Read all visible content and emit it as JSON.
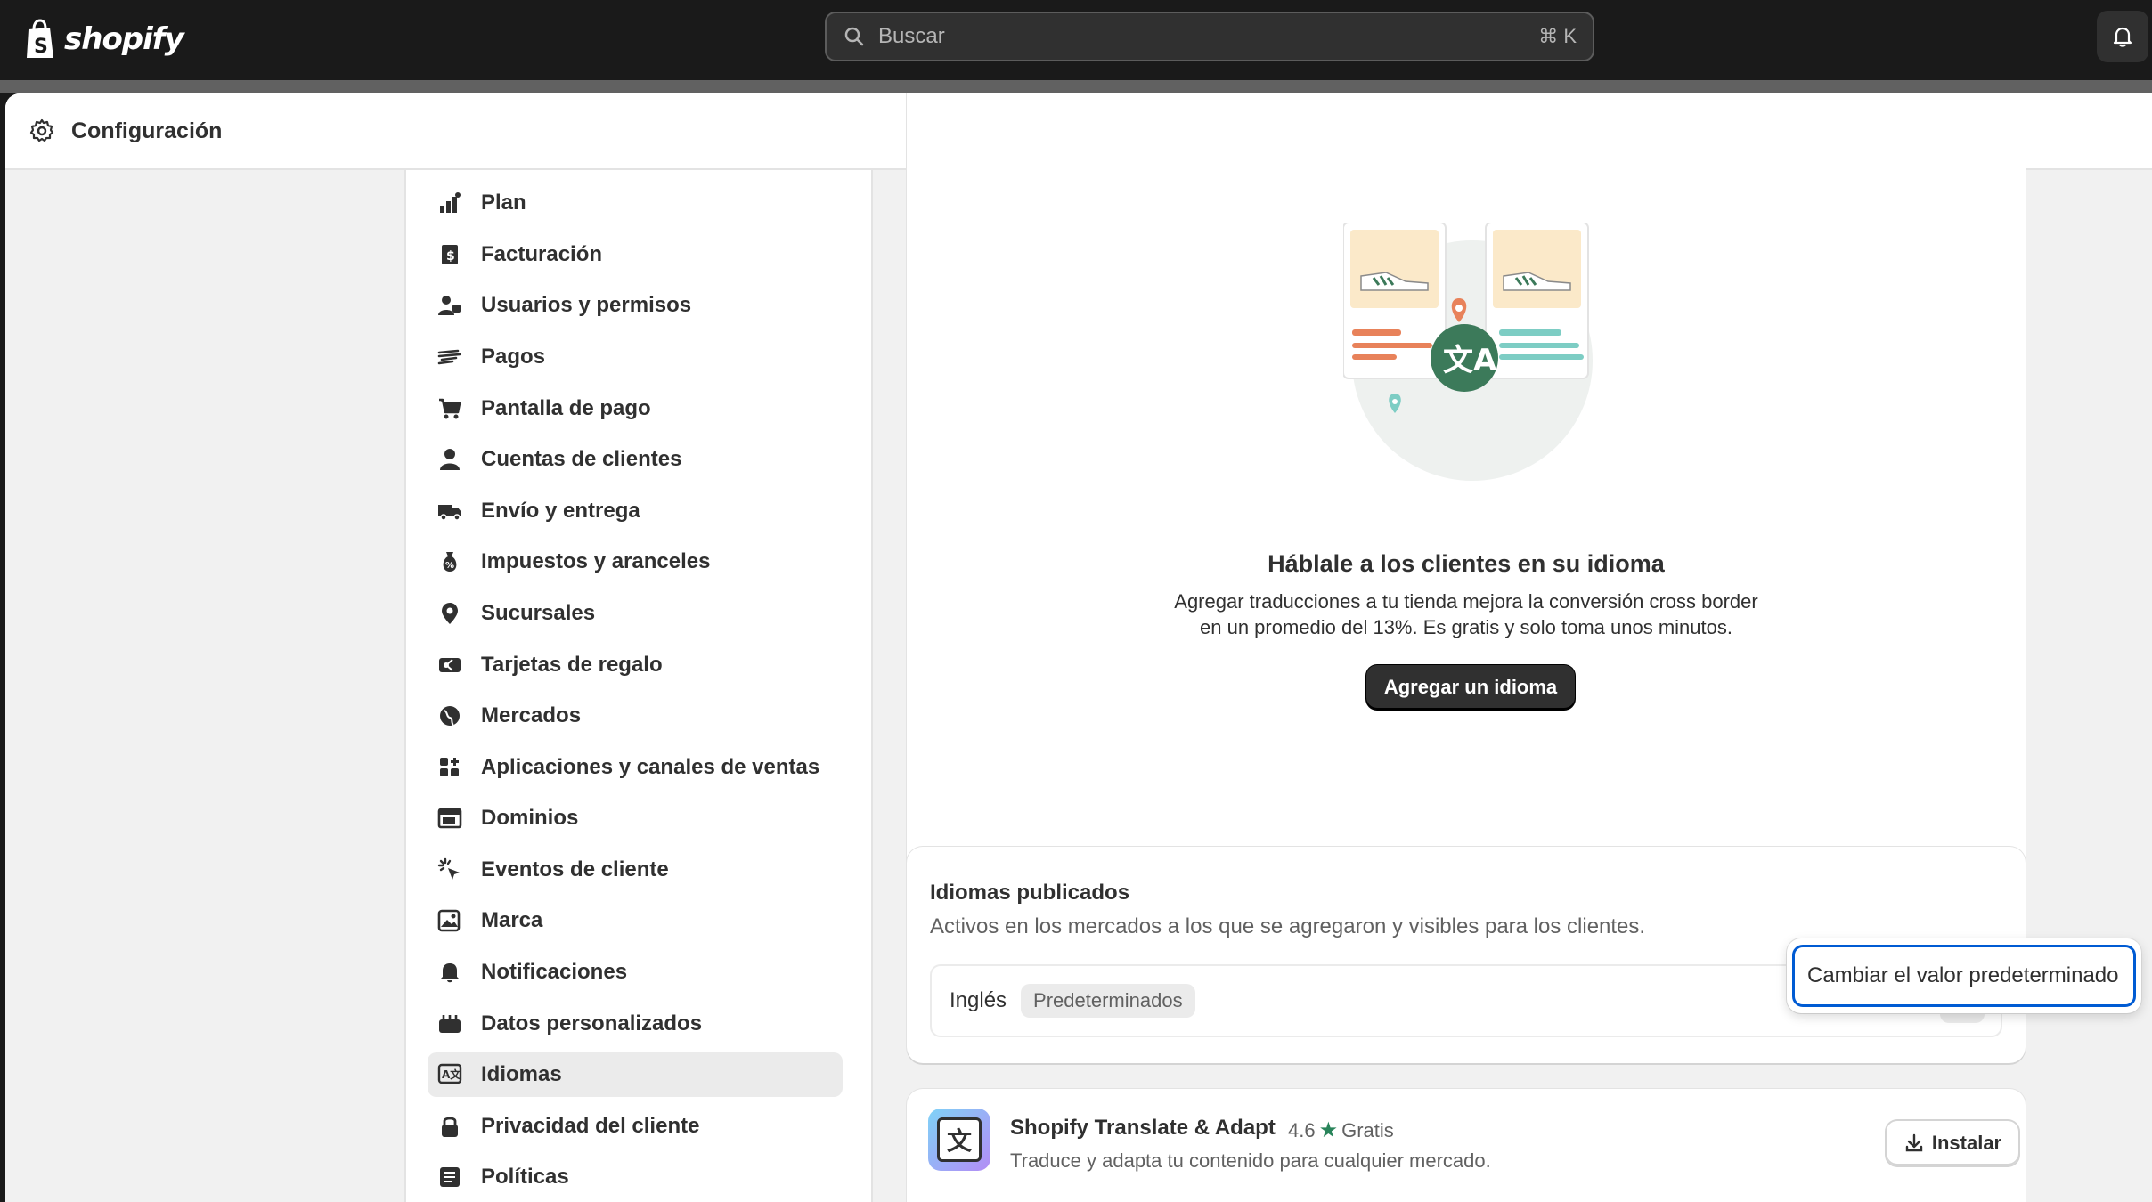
{
  "topbar": {
    "brand": "shopify",
    "search_placeholder": "Buscar",
    "search_shortcut": "⌘ K",
    "notifications_icon": "bell-icon"
  },
  "header": {
    "title": "Configuración",
    "icon": "gear-icon"
  },
  "sidebar": {
    "items": [
      {
        "label": "Plan",
        "icon": "plan-icon"
      },
      {
        "label": "Facturación",
        "icon": "billing-icon"
      },
      {
        "label": "Usuarios y permisos",
        "icon": "users-icon"
      },
      {
        "label": "Pagos",
        "icon": "payments-icon"
      },
      {
        "label": "Pantalla de pago",
        "icon": "cart-icon"
      },
      {
        "label": "Cuentas de clientes",
        "icon": "person-icon"
      },
      {
        "label": "Envío y entrega",
        "icon": "truck-icon"
      },
      {
        "label": "Impuestos y aranceles",
        "icon": "tax-icon"
      },
      {
        "label": "Sucursales",
        "icon": "location-icon"
      },
      {
        "label": "Tarjetas de regalo",
        "icon": "gift-card-icon"
      },
      {
        "label": "Mercados",
        "icon": "globe-icon"
      },
      {
        "label": "Aplicaciones y canales de ventas",
        "icon": "apps-icon"
      },
      {
        "label": "Dominios",
        "icon": "domains-icon"
      },
      {
        "label": "Eventos de cliente",
        "icon": "cursor-icon"
      },
      {
        "label": "Marca",
        "icon": "brand-icon"
      },
      {
        "label": "Notificaciones",
        "icon": "bell-icon"
      },
      {
        "label": "Datos personalizados",
        "icon": "data-icon"
      },
      {
        "label": "Idiomas",
        "icon": "language-icon",
        "active": true
      },
      {
        "label": "Privacidad del cliente",
        "icon": "lock-icon"
      },
      {
        "label": "Políticas",
        "icon": "policy-icon"
      }
    ]
  },
  "hero": {
    "title": "Háblale a los clientes en su idioma",
    "description": "Agregar traducciones a tu tienda mejora la conversión cross border en un promedio del 13%. Es gratis y solo toma unos minutos.",
    "button": "Agregar un idioma"
  },
  "published": {
    "title": "Idiomas publicados",
    "subtitle": "Activos en los mercados a los que se agregaron y visibles para los clientes.",
    "language": "Inglés",
    "badge": "Predeterminados"
  },
  "popover": {
    "item": "Cambiar el valor predeterminado"
  },
  "app": {
    "name": "Shopify Translate & Adapt",
    "rating": "4.6",
    "price": "Gratis",
    "description": "Traduce y adapta tu contenido para cualquier mercado.",
    "install": "Instalar"
  },
  "colors": {
    "accent": "#303030",
    "focus": "#005bd3",
    "translate_green": "#3c7a5a"
  }
}
